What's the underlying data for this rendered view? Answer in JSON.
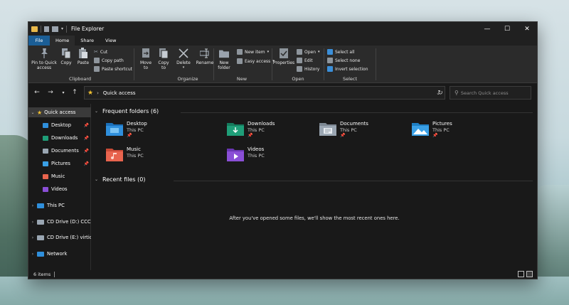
{
  "window": {
    "title": "File Explorer",
    "controls": {
      "minimize": "—",
      "maximize": "☐",
      "close": "✕"
    }
  },
  "tabs": [
    {
      "label": "File"
    },
    {
      "label": "Home"
    },
    {
      "label": "Share"
    },
    {
      "label": "View"
    }
  ],
  "ribbon": {
    "clipboard": {
      "label": "Clipboard",
      "pin": "Pin to Quick\naccess",
      "copy": "Copy",
      "paste": "Paste",
      "cut": "Cut",
      "copy_path": "Copy path",
      "paste_shortcut": "Paste shortcut"
    },
    "organize": {
      "label": "Organize",
      "move_to": "Move\nto",
      "copy_to": "Copy\nto",
      "delete": "Delete",
      "rename": "Rename"
    },
    "new": {
      "label": "New",
      "new_folder": "New\nfolder",
      "new_item": "New item",
      "easy_access": "Easy access"
    },
    "open": {
      "label": "Open",
      "properties": "Properties",
      "open": "Open",
      "edit": "Edit",
      "history": "History"
    },
    "select": {
      "label": "Select",
      "select_all": "Select all",
      "select_none": "Select none",
      "invert_selection": "Invert selection"
    }
  },
  "address": {
    "path": "Quick access",
    "search_placeholder": "Search Quick access"
  },
  "nav_pane": {
    "items": [
      {
        "label": "Quick access",
        "icon": "star-icon",
        "color": "#f2c230"
      },
      {
        "label": "Desktop",
        "icon": "desktop-folder-icon",
        "color": "#2f8fdc",
        "pinned": true
      },
      {
        "label": "Downloads",
        "icon": "downloads-folder-icon",
        "color": "#1f9e78",
        "pinned": true
      },
      {
        "label": "Documents",
        "icon": "documents-folder-icon",
        "color": "#9aa6b2",
        "pinned": true
      },
      {
        "label": "Pictures",
        "icon": "pictures-folder-icon",
        "color": "#3aa0e6",
        "pinned": true
      },
      {
        "label": "Music",
        "icon": "music-folder-icon",
        "color": "#e8644e"
      },
      {
        "label": "Videos",
        "icon": "videos-folder-icon",
        "color": "#8a4fd6"
      },
      {
        "label": "This PC",
        "icon": "pc-icon",
        "color": "#2f8fdc"
      },
      {
        "label": "CD Drive (D:) CCCOI",
        "icon": "cd-drive-icon",
        "color": "#9aa6b2"
      },
      {
        "label": "CD Drive (E:) virtio-v",
        "icon": "cd-drive-icon",
        "color": "#9aa6b2"
      },
      {
        "label": "Network",
        "icon": "network-icon",
        "color": "#2f8fdc"
      }
    ]
  },
  "content": {
    "frequent_header": "Frequent folders (6)",
    "recent_header": "Recent files (0)",
    "empty_message": "After you've opened some files, we'll show the most recent ones here.",
    "folders": [
      {
        "name": "Desktop",
        "location": "This PC",
        "pinned": true,
        "icon": "desktop-folder-icon",
        "color": "#2f8fdc"
      },
      {
        "name": "Downloads",
        "location": "This PC",
        "pinned": true,
        "icon": "downloads-folder-icon",
        "color": "#1f9e78"
      },
      {
        "name": "Documents",
        "location": "This PC",
        "pinned": true,
        "icon": "documents-folder-icon",
        "color": "#9aa6b2"
      },
      {
        "name": "Pictures",
        "location": "This PC",
        "pinned": true,
        "icon": "pictures-folder-icon",
        "color": "#3aa0e6"
      },
      {
        "name": "Music",
        "location": "This PC",
        "pinned": false,
        "icon": "music-folder-icon",
        "color": "#e8644e"
      },
      {
        "name": "Videos",
        "location": "This PC",
        "pinned": false,
        "icon": "videos-folder-icon",
        "color": "#8a4fd6"
      }
    ]
  },
  "status": {
    "item_count": "6 items"
  }
}
